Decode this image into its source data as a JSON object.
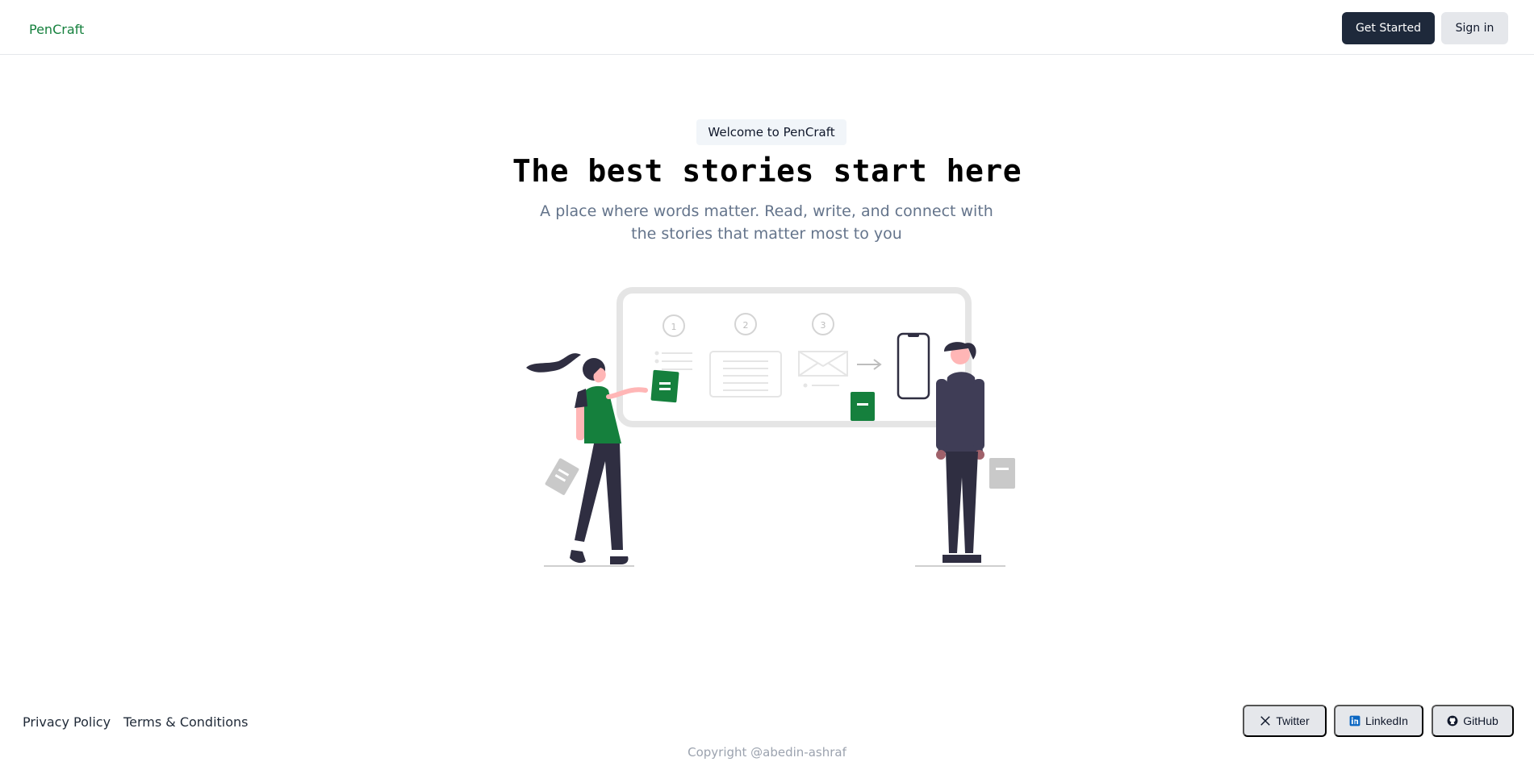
{
  "header": {
    "brand": "PenCraft",
    "get_started_label": "Get Started",
    "sign_in_label": "Sign in"
  },
  "hero": {
    "badge": "Welcome to PenCraft",
    "title": "The best stories start here",
    "subtitle": "A place where words matter. Read, write, and connect with the stories that matter most to you"
  },
  "illustration": {
    "steps": [
      "1",
      "2",
      "3"
    ],
    "icons": [
      "board-icon",
      "phone-icon",
      "arrow-right-icon",
      "document-icon",
      "woman-figure",
      "man-figure"
    ]
  },
  "footer": {
    "links": [
      "Privacy Policy",
      "Terms & Conditions"
    ],
    "social": {
      "twitter": "Twitter",
      "linkedin": "LinkedIn",
      "github": "GitHub"
    },
    "copyright": "Copyright @abedin-ashraf"
  },
  "colors": {
    "accent": "#15803d",
    "primary_button": "#1e293b",
    "secondary_button": "#e5e7eb",
    "muted_text": "#64748b"
  }
}
